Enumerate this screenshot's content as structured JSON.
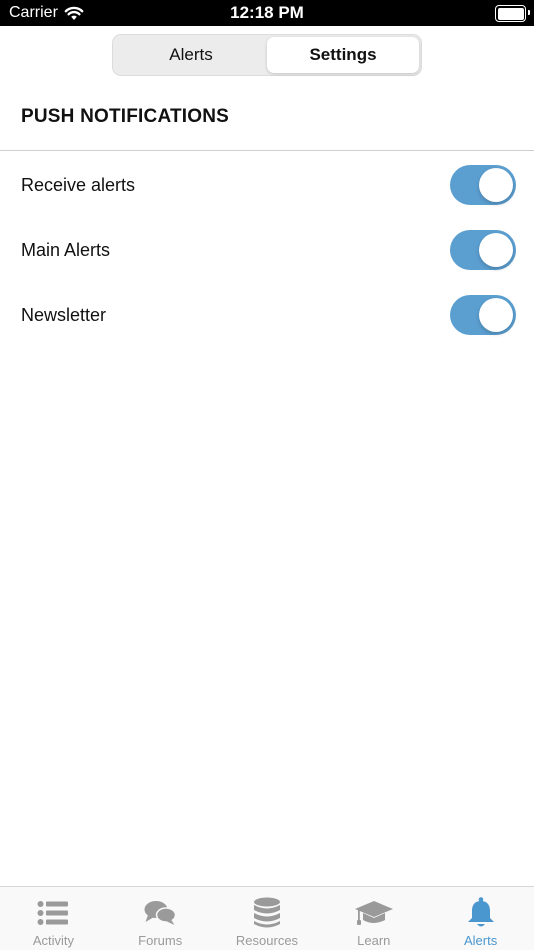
{
  "status_bar": {
    "carrier": "Carrier",
    "time": "12:18 PM"
  },
  "segmented": {
    "segments": [
      {
        "label": "Alerts",
        "selected": false
      },
      {
        "label": "Settings",
        "selected": true
      }
    ]
  },
  "section": {
    "title": "PUSH NOTIFICATIONS"
  },
  "settings": [
    {
      "label": "Receive alerts",
      "on": true
    },
    {
      "label": "Main Alerts",
      "on": true
    },
    {
      "label": "Newsletter",
      "on": true
    }
  ],
  "tab_bar": {
    "tabs": [
      {
        "label": "Activity",
        "icon": "list-icon",
        "active": false
      },
      {
        "label": "Forums",
        "icon": "chat-bubbles-icon",
        "active": false
      },
      {
        "label": "Resources",
        "icon": "database-icon",
        "active": false
      },
      {
        "label": "Learn",
        "icon": "graduation-cap-icon",
        "active": false
      },
      {
        "label": "Alerts",
        "icon": "bell-icon",
        "active": true
      }
    ]
  },
  "colors": {
    "accent": "#4a96cf",
    "toggle_on": "#5b9fd1",
    "tab_inactive": "#9a9a9a"
  }
}
